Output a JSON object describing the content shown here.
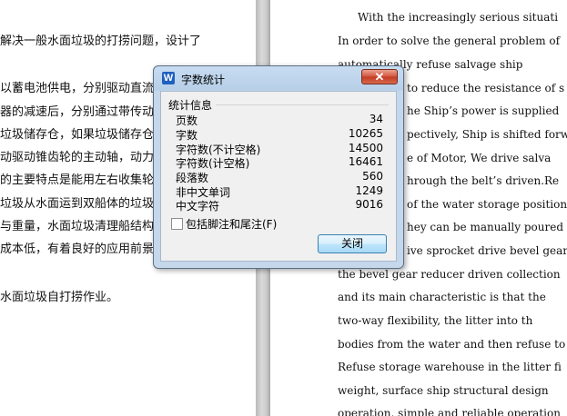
{
  "document": {
    "left_lines": [
      "解决一般水面垃圾的打捞问题，设计了",
      "",
      "以蓄电池供电，分别驱动直流",
      "器的减速后，分别通过带传动",
      "垃圾储存仓，如果垃圾储存仓装",
      "动驱动锥齿轮的主动轴，动力",
      "的主要特点是能用左右收集轮",
      "垃圾从水面运到双船体的垃圾",
      "与重量，水面垃圾清理船结构设",
      "成本低，有着良好的应用前景",
      "",
      "水面垃圾自打捞作业。"
    ],
    "right_lines": [
      "With the increasingly serious situati",
      "In order to solve the general problem of",
      "automatically refuse salvage ship",
      "to reduce the resistance of s",
      "he Ship’s power is supplied",
      "pectively, Ship is shifted forw",
      "e of Motor, We drive  salva",
      "hrough the belt’s driven.Re",
      "of the water storage position",
      "hey can be manually poured in",
      "ive sprocket drive bevel gear",
      "the bevel gear reducer driven collection",
      "and its main characteristic is that the",
      "two-way flexibility, the litter into th",
      "bodies from the water and then refuse to",
      "Refuse storage warehouse in the litter fi",
      "weight, surface ship structural design",
      "operation, simple and reliable operation"
    ]
  },
  "dialog": {
    "title": "字数统计",
    "app_icon_letter": "W",
    "close_glyph": "✕",
    "group_label": "统计信息",
    "stats": [
      {
        "label": "页数",
        "value": "34"
      },
      {
        "label": "字数",
        "value": "10265"
      },
      {
        "label": "字符数(不计空格)",
        "value": "14500"
      },
      {
        "label": "字符数(计空格)",
        "value": "16461"
      },
      {
        "label": "段落数",
        "value": "560"
      },
      {
        "label": "非中文单词",
        "value": "1249"
      },
      {
        "label": "中文字符",
        "value": "9016"
      }
    ],
    "checkbox_label": "包括脚注和尾注(F)",
    "checkbox_checked": false,
    "ok_label": "关闭"
  }
}
